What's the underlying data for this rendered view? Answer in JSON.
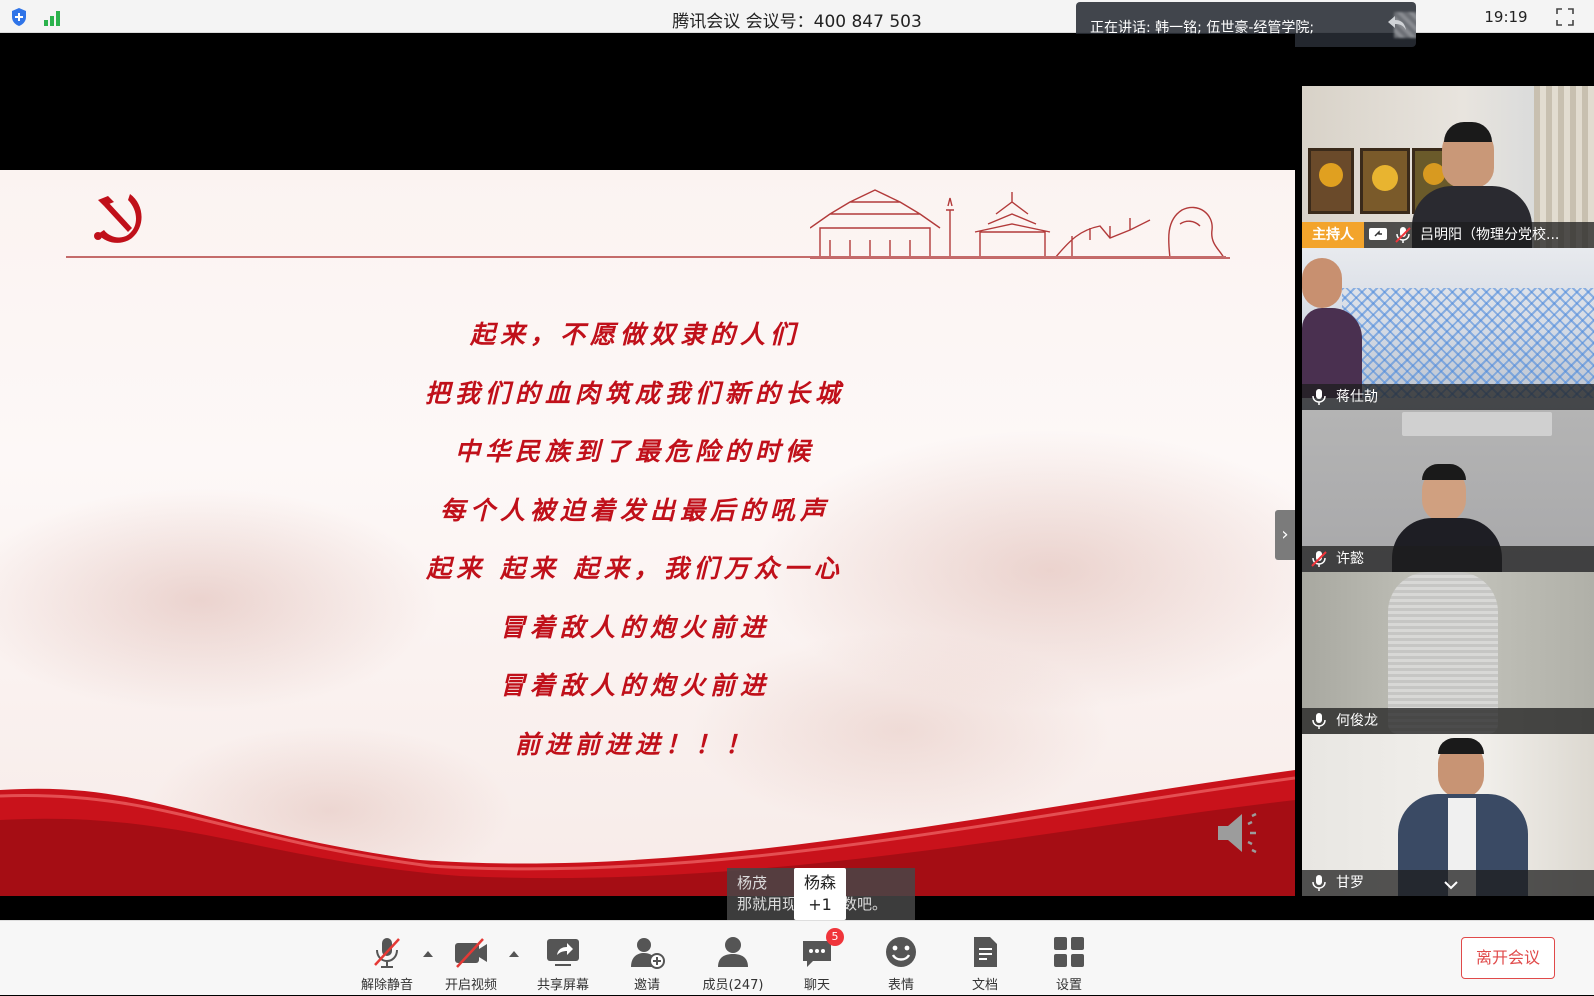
{
  "titlebar": {
    "title": "腾讯会议 会议号：400 847 503",
    "clock": "19:19",
    "icons": [
      "shield-icon",
      "signal-icon",
      "fullscreen-icon"
    ]
  },
  "speaking": {
    "text": "正在讲话: 韩一铭; 伍世豪-经管学院;"
  },
  "slide": {
    "lines": [
      "起来，不愿做奴隶的人们",
      "把我们的血肉筑成我们新的长城",
      "中华民族到了最危险的时候",
      "每个人被迫着发出最后的吼声",
      "起来 起来 起来，我们万众一心",
      "冒着敌人的炮火前进",
      "冒着敌人的炮火前进",
      "前进前进进！！！"
    ],
    "next_arrow": "›"
  },
  "chat_popup": {
    "sender": "杨茂",
    "message": "那就用现在的人数吧。",
    "bubble_name": "杨森",
    "bubble_count": "+1"
  },
  "gallery": {
    "tiles": [
      {
        "name": "吕明阳（物理分党校...",
        "host_badge": "主持人",
        "mic": "muted"
      },
      {
        "name": "蒋仕劼",
        "mic": "on"
      },
      {
        "name": "许懿",
        "mic": "muted"
      },
      {
        "name": "何俊龙",
        "mic": "on"
      },
      {
        "name": "甘罗",
        "mic": "on"
      }
    ]
  },
  "toolbar": {
    "items": [
      {
        "label": "解除静音"
      },
      {
        "label": "开启视频"
      },
      {
        "label": "共享屏幕"
      },
      {
        "label": "邀请"
      },
      {
        "label": "成员(247)"
      },
      {
        "label": "聊天",
        "badge": "5"
      },
      {
        "label": "表情"
      },
      {
        "label": "文档"
      },
      {
        "label": "设置"
      }
    ],
    "leave": "离开会议"
  },
  "colors": {
    "lyric_red": "#c0101a",
    "host_badge": "#f3a42c",
    "leave_red": "#e04a4a",
    "badge_red": "#f0353b"
  }
}
